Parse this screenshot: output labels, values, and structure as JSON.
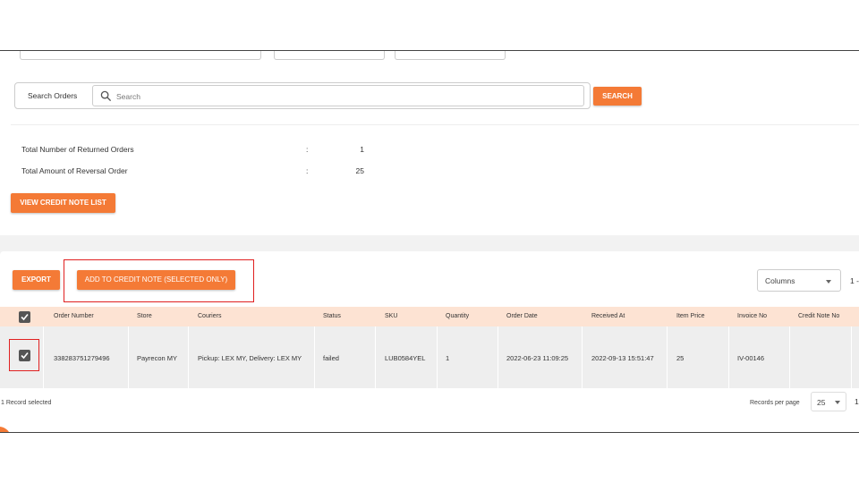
{
  "search": {
    "label": "Search Orders",
    "placeholder": "Search",
    "button_label": "SEARCH"
  },
  "summary": {
    "rows": [
      {
        "label": "Total Number of Returned Orders",
        "colon": ":",
        "value": "1"
      },
      {
        "label": "Total Amount of Reversal Order",
        "colon": ":",
        "value": "25"
      }
    ],
    "view_credit_note_label": "VIEW CREDIT NOTE LIST"
  },
  "toolbar": {
    "export_label": "EXPORT",
    "add_credit_note_label": "ADD TO CREDIT NOTE (SELECTED ONLY)",
    "columns_label": "Columns",
    "pagination_text": "1 -"
  },
  "table": {
    "headers": [
      "Order Number",
      "Store",
      "Couriers",
      "Status",
      "SKU",
      "Quantity",
      "Order Date",
      "Received At",
      "Item Price",
      "Invoice No",
      "Credit Note No"
    ],
    "rows": [
      {
        "order_number": "338283751279496",
        "store": "Payrecon MY",
        "couriers": "Pickup: LEX MY, Delivery: LEX MY",
        "status": "failed",
        "sku": "LUB0584YEL",
        "quantity": "1",
        "order_date": "2022-06-23 11:09:25",
        "received_at": "2022-09-13 15:51:47",
        "item_price": "25",
        "invoice_no": "IV-00146",
        "credit_note_no": ""
      }
    ]
  },
  "footer": {
    "selected_text": "1 Record selected",
    "records_per_page_label": "Records per page",
    "records_per_page_value": "25",
    "page_text": "1"
  },
  "colors": {
    "accent": "#f47a36",
    "header_bg": "#fde3d3",
    "highlight": "#e02020"
  }
}
